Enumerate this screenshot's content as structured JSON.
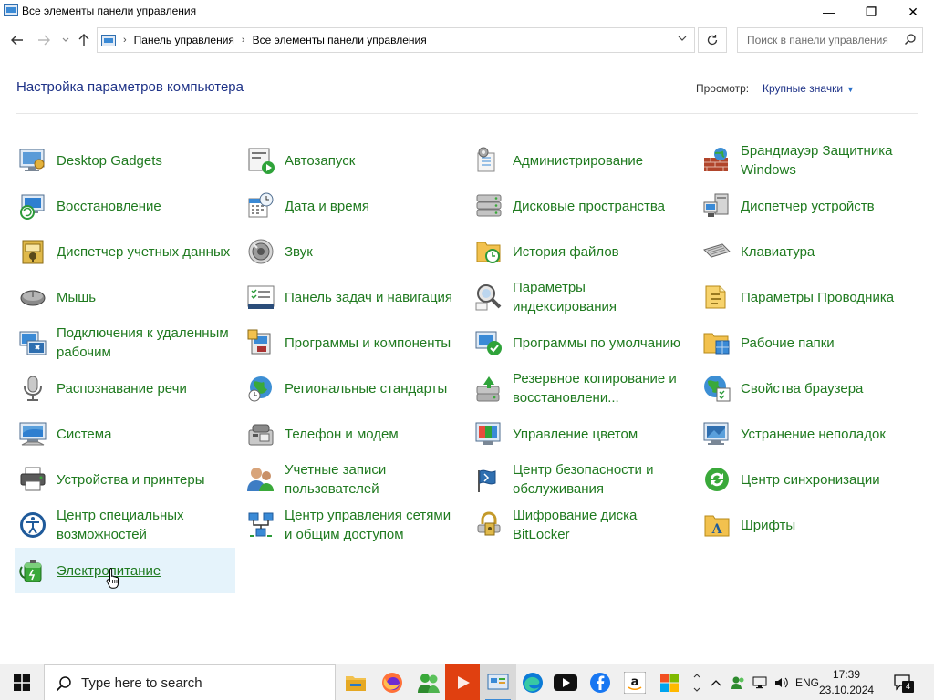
{
  "window": {
    "title": "Все элементы панели управления",
    "minimize": "—",
    "maximize": "❐",
    "close": "✕"
  },
  "nav": {
    "breadcrumb": [
      "Панель управления",
      "Все элементы панели управления"
    ],
    "search_placeholder": "Поиск в панели управления"
  },
  "header": {
    "title": "Настройка параметров компьютера",
    "view_label": "Просмотр:",
    "view_value": "Крупные значки"
  },
  "items": [
    {
      "label": "Desktop Gadgets",
      "icon": "gadgets-icon"
    },
    {
      "label": "Автозапуск",
      "icon": "autoplay-icon"
    },
    {
      "label": "Администрирование",
      "icon": "admin-tools-icon"
    },
    {
      "label": "Брандмауэр Защитника Windows",
      "icon": "firewall-icon"
    },
    {
      "label": "Восстановление",
      "icon": "recovery-icon"
    },
    {
      "label": "Дата и время",
      "icon": "datetime-icon"
    },
    {
      "label": "Дисковые пространства",
      "icon": "storage-spaces-icon"
    },
    {
      "label": "Диспетчер устройств",
      "icon": "device-manager-icon"
    },
    {
      "label": "Диспетчер учетных данных",
      "icon": "credential-manager-icon"
    },
    {
      "label": "Звук",
      "icon": "sound-icon"
    },
    {
      "label": "История файлов",
      "icon": "file-history-icon"
    },
    {
      "label": "Клавиатура",
      "icon": "keyboard-icon"
    },
    {
      "label": "Мышь",
      "icon": "mouse-icon"
    },
    {
      "label": "Панель задач и навигация",
      "icon": "taskbar-icon"
    },
    {
      "label": "Параметры индексирования",
      "icon": "indexing-icon"
    },
    {
      "label": "Параметры Проводника",
      "icon": "explorer-options-icon"
    },
    {
      "label": "Подключения к удаленным рабочим",
      "icon": "remoteapp-icon"
    },
    {
      "label": "Программы и компоненты",
      "icon": "programs-icon"
    },
    {
      "label": "Программы по умолчанию",
      "icon": "default-programs-icon"
    },
    {
      "label": "Рабочие папки",
      "icon": "work-folders-icon"
    },
    {
      "label": "Распознавание речи",
      "icon": "speech-icon"
    },
    {
      "label": "Региональные стандарты",
      "icon": "region-icon"
    },
    {
      "label": "Резервное копирование и восстановлени...",
      "icon": "backup-icon"
    },
    {
      "label": "Свойства браузера",
      "icon": "internet-options-icon"
    },
    {
      "label": "Система",
      "icon": "system-icon"
    },
    {
      "label": "Телефон и модем",
      "icon": "phone-modem-icon"
    },
    {
      "label": "Управление цветом",
      "icon": "color-management-icon"
    },
    {
      "label": "Устранение неполадок",
      "icon": "troubleshooting-icon"
    },
    {
      "label": "Устройства и принтеры",
      "icon": "devices-printers-icon"
    },
    {
      "label": "Учетные записи пользователей",
      "icon": "user-accounts-icon"
    },
    {
      "label": "Центр безопасности и обслуживания",
      "icon": "security-center-icon"
    },
    {
      "label": "Центр синхронизации",
      "icon": "sync-center-icon"
    },
    {
      "label": "Центр специальных возможностей",
      "icon": "ease-of-access-icon"
    },
    {
      "label": "Центр управления сетями и общим доступом",
      "icon": "network-center-icon"
    },
    {
      "label": "Шифрование диска BitLocker",
      "icon": "bitlocker-icon"
    },
    {
      "label": "Шрифты",
      "icon": "fonts-icon"
    },
    {
      "label": "Электропитание",
      "icon": "power-options-icon",
      "hovered": true
    }
  ],
  "taskbar": {
    "search_text": "Type here to search",
    "apps": [
      "file-explorer-icon",
      "firefox-icon",
      "people-icon",
      "media-player-icon",
      "control-panel-icon",
      "edge-icon",
      "youtube-icon",
      "facebook-icon",
      "amazon-icon",
      "microsoft-store-icon"
    ],
    "language": "ENG",
    "time": "17:39",
    "date": "23.10.2024",
    "notifications": "4"
  },
  "colors": {
    "link_green": "#1f7a1f",
    "heading_blue": "#1e3287",
    "hover_bg": "#e5f3fb"
  }
}
